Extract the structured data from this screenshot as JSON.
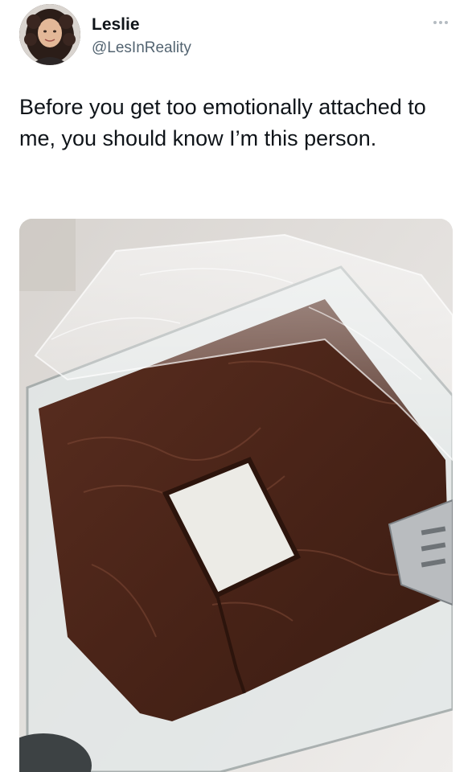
{
  "tweet": {
    "author_name": "Leslie",
    "author_handle": "@LesInReality",
    "text": "Before you get too emotionally attached to me, you should know I’m this person.",
    "more_icon": "more-horizontal-icon"
  },
  "media": {
    "description_icon": "photo"
  },
  "colors": {
    "text_primary": "#0f1419",
    "text_secondary": "#536471",
    "brownie": "#4a2418"
  }
}
